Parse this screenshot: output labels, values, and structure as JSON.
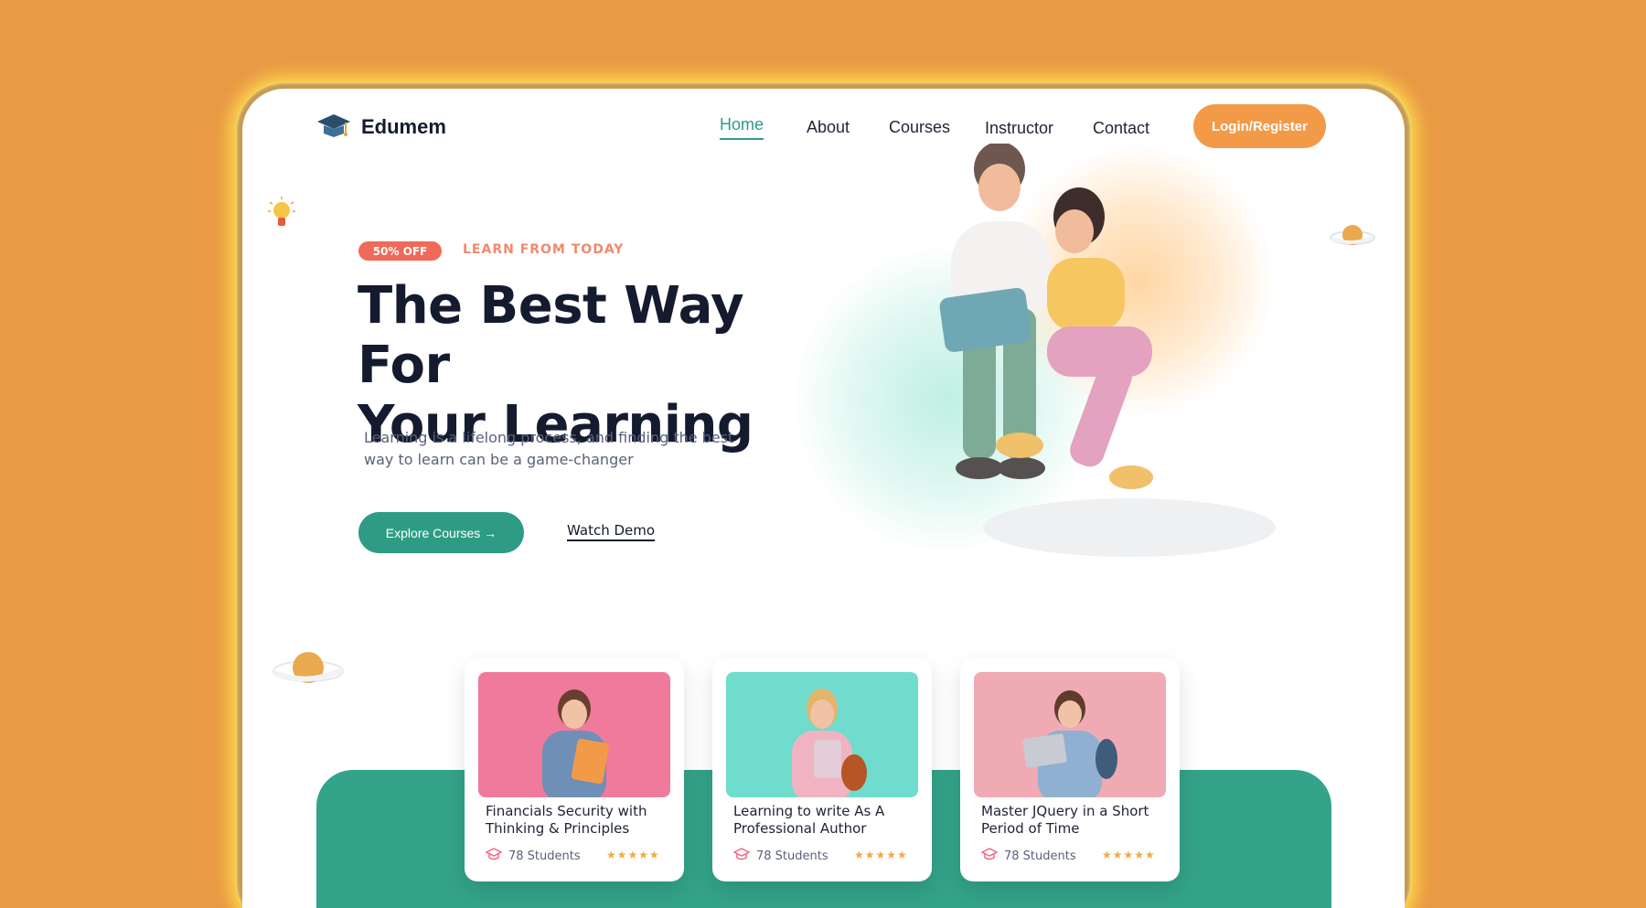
{
  "brand": {
    "name": "Edumem"
  },
  "nav": {
    "items": [
      {
        "label": "Home",
        "active": true
      },
      {
        "label": "About",
        "active": false
      },
      {
        "label": "Courses",
        "active": false
      },
      {
        "label": "Instructor",
        "active": false
      },
      {
        "label": "Contact",
        "active": false
      }
    ],
    "login_label": "Login/Register"
  },
  "hero": {
    "badge": "50% OFF",
    "tagline": "LEARN FROM TODAY",
    "title_line1": "The Best Way For",
    "title_line2": "Your Learning",
    "subtitle": "Learning is a lifelong process, and finding the best way to learn can be a game-changer",
    "explore_label": "Explore Courses →",
    "watch_label": "Watch Demo"
  },
  "courses": [
    {
      "title": "Financials Security with Thinking & Principles",
      "students": "78 Students",
      "rating": 5,
      "image_bg": "#f07a9c"
    },
    {
      "title": "Learning to write As A Professional Author",
      "students": "78 Students",
      "rating": 5,
      "image_bg": "#6fdccd"
    },
    {
      "title": "Master JQuery in a Short Period of Time",
      "students": "78 Students",
      "rating": 5,
      "image_bg": "#f0aab4"
    }
  ],
  "colors": {
    "primary": "#2e9c85",
    "accent": "#f29a47",
    "badge": "#ef6a58",
    "background": "#e89a45"
  }
}
